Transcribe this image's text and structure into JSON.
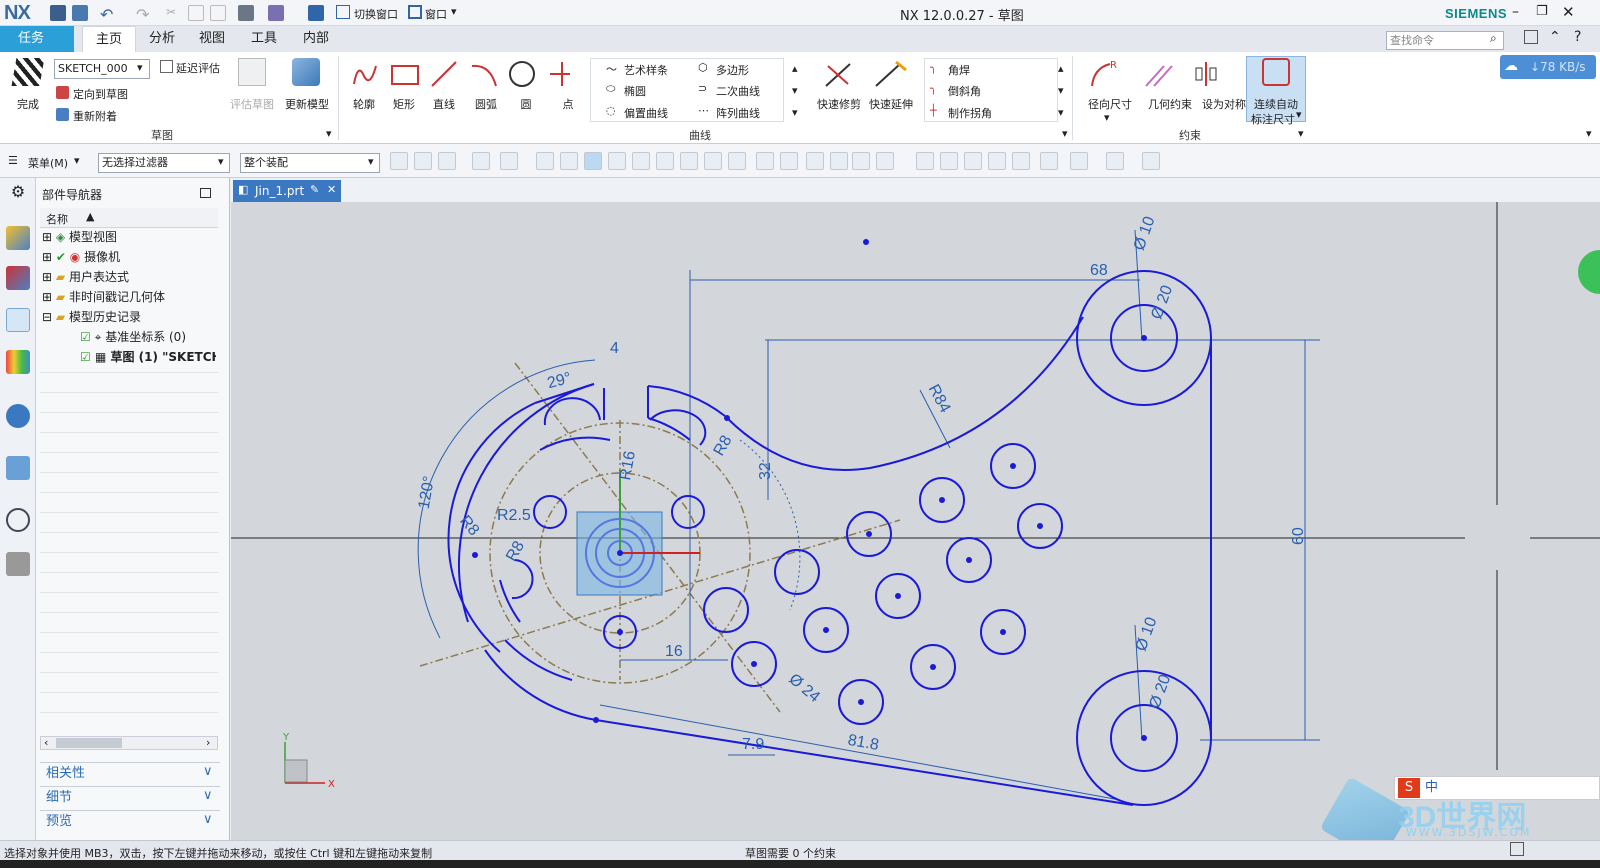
{
  "titlebar": {
    "logo": "NX",
    "switch_window": "切换窗口",
    "window_menu": "窗口",
    "title": "NX 12.0.0.27 - 草图",
    "brand": "SIEMENS"
  },
  "menubar": {
    "tabs": [
      "任务(T)",
      "主页",
      "分析",
      "视图",
      "工具",
      "内部"
    ],
    "active": "主页",
    "search_placeholder": "查找命令",
    "net_speed": "↓78 KB/s"
  },
  "ribbon": {
    "sketch_group": {
      "finish": "完成",
      "sketch_name": "SKETCH_000",
      "delay_eval": "延迟评估",
      "orient_to_sketch": "定向到草图",
      "reattach": "重新附着",
      "eval_sketch": "评估草图",
      "update_model": "更新模型",
      "label": "草图"
    },
    "curve_group": {
      "profile": "轮廓",
      "rectangle": "矩形",
      "line": "直线",
      "arc": "圆弧",
      "circle": "圆",
      "point": "点",
      "art_spline": "艺术样条",
      "polygon": "多边形",
      "ellipse": "椭圆",
      "conic": "二次曲线",
      "offset_curve": "偏置曲线",
      "pattern_curve": "阵列曲线",
      "quick_trim": "快速修剪",
      "quick_extend": "快速延伸",
      "fillet": "角焊",
      "chamfer": "倒斜角",
      "make_corner": "制作拐角",
      "label": "曲线"
    },
    "constraint_group": {
      "radial_dim": "径向尺寸",
      "geo_constraint": "几何约束",
      "set_symmetric": "设为对称",
      "auto_dim": "连续自动",
      "auto_dim2": "标注尺寸",
      "label": "约束"
    }
  },
  "toolbar2": {
    "menu": "菜单(M)",
    "filter": "无选择过滤器",
    "assembly": "整个装配"
  },
  "navigator": {
    "title": "部件导航器",
    "column": "名称",
    "items": [
      {
        "label": "模型视图",
        "level": 0
      },
      {
        "label": "摄像机",
        "level": 0
      },
      {
        "label": "用户表达式",
        "level": 0
      },
      {
        "label": "非时间戳记几何体",
        "level": 0
      },
      {
        "label": "模型历史记录",
        "level": 0
      },
      {
        "label": "基准坐标系 (0)",
        "level": 1
      },
      {
        "label": "草图 (1) \"SKETCH_",
        "level": 1
      }
    ],
    "accordions": [
      "相关性",
      "细节",
      "预览"
    ]
  },
  "document": {
    "tab": "Jin_1.prt"
  },
  "sketch": {
    "dims": [
      "68",
      "Ø 10",
      "R84",
      "32",
      "R8",
      "60",
      "R2.5",
      "R8",
      "29°",
      "4",
      "120°",
      "R16",
      "Ø 24",
      "16",
      "7.9",
      "81.8",
      "Ø 10",
      "Ø 20",
      "Ø 20",
      "R8"
    ]
  },
  "status": {
    "left": "选择对象并使用 MB3，双击，按下左键并拖动来移动，或按住 Ctrl 键和左键拖动来复制",
    "center": "草图需要 0 个约束"
  },
  "watermark": {
    "brand": "3D世界网",
    "url": "WWW.3DSJW.COM"
  },
  "ime": {
    "label": "中"
  },
  "colors": {
    "sketch_blue": "#1a1ad8",
    "construction": "#8d7a50",
    "ribbon_accent": "#2a9fd8"
  }
}
